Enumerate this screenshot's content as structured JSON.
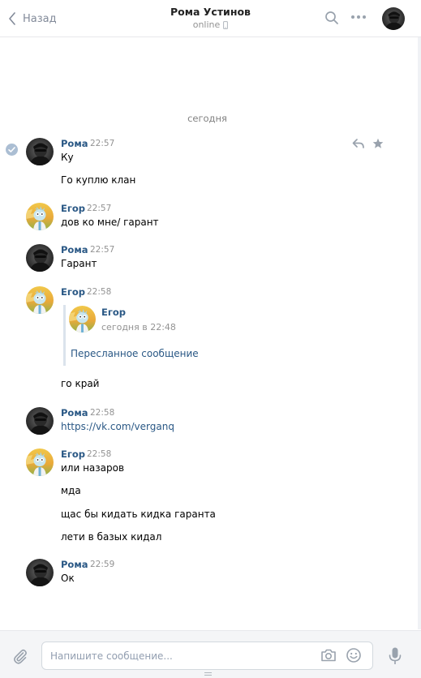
{
  "header": {
    "back_label": "Назад",
    "title": "Рома Устинов",
    "status": "online"
  },
  "day_separator": "сегодня",
  "messages": [
    {
      "name": "Рома",
      "time": "22:57",
      "lines": [
        "Ку",
        "Го куплю клан"
      ]
    },
    {
      "name": "Егор",
      "time": "22:57",
      "lines": [
        "дов ко мне/ гарант"
      ]
    },
    {
      "name": "Рома",
      "time": "22:57",
      "lines": [
        "Гарант"
      ]
    },
    {
      "name": "Егор",
      "time": "22:58",
      "forward": {
        "name": "Егор",
        "date": "сегодня в 22:48",
        "link": "Пересланное сообщение"
      },
      "lines": [
        "го край"
      ]
    },
    {
      "name": "Рома",
      "time": "22:58",
      "lines": [
        "https://vk.com/verganq"
      ]
    },
    {
      "name": "Егор",
      "time": "22:58",
      "lines": [
        "или назаров",
        "мда",
        "щас бы кидать кидка гаранта",
        "лети в базых кидал"
      ]
    },
    {
      "name": "Рома",
      "time": "22:59",
      "lines": [
        "Ок"
      ]
    }
  ],
  "composer": {
    "placeholder": "Напишите сообщение..."
  },
  "colors": {
    "accent": "#2a5885",
    "muted": "#939393",
    "icon": "#99a2ad"
  }
}
